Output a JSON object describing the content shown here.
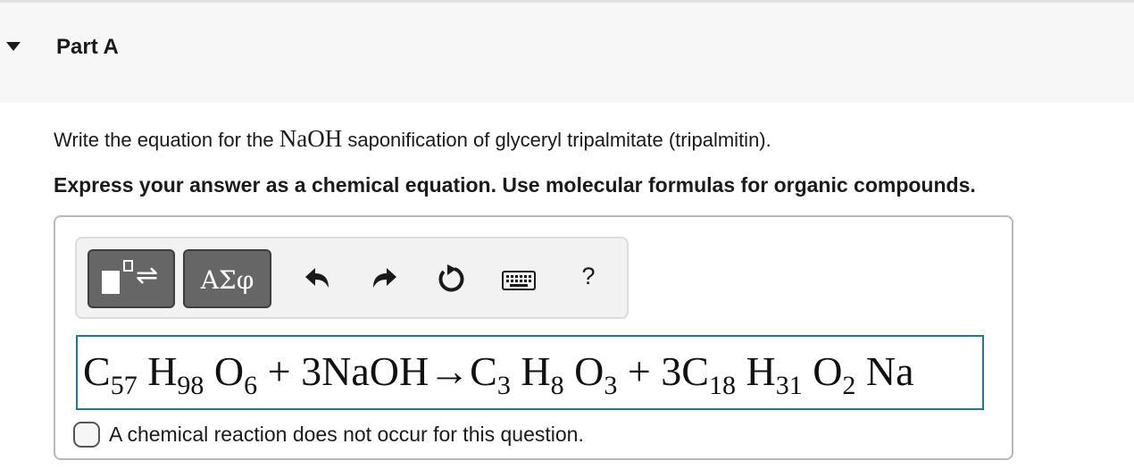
{
  "part": {
    "title": "Part A"
  },
  "question": {
    "text_before": "Write the equation for the ",
    "math": "NaOH",
    "text_after": " saponification of glyceryl tripalmitate (tripalmitin)."
  },
  "instruction": "Express your answer as a chemical equation. Use molecular formulas for organic compounds.",
  "toolbar": {
    "templates_icon": "templates-arrows-icon",
    "symbols_label": "ΑΣφ",
    "undo_icon": "undo-icon",
    "redo_icon": "redo-icon",
    "reset_icon": "reset-icon",
    "keyboard_icon": "keyboard-icon",
    "help_label": "?"
  },
  "answer": {
    "tokens": [
      {
        "t": "C"
      },
      {
        "s": "57"
      },
      {
        "t": " H"
      },
      {
        "s": "98"
      },
      {
        "t": " O"
      },
      {
        "s": "6"
      },
      {
        "t": " + 3NaOH→C"
      },
      {
        "s": "3"
      },
      {
        "t": " H"
      },
      {
        "s": "8"
      },
      {
        "t": " O"
      },
      {
        "s": "3"
      },
      {
        "t": " + 3C"
      },
      {
        "s": "18"
      },
      {
        "t": " H"
      },
      {
        "s": "31"
      },
      {
        "t": " O"
      },
      {
        "s": "2"
      },
      {
        "t": " Na"
      }
    ]
  },
  "no_reaction": {
    "checked": false,
    "label": "A chemical reaction does not occur for this question."
  },
  "colors": {
    "input_border": "#1f7a8c",
    "button_bg": "#666666",
    "toolbar_bg": "#f2f2f2"
  }
}
